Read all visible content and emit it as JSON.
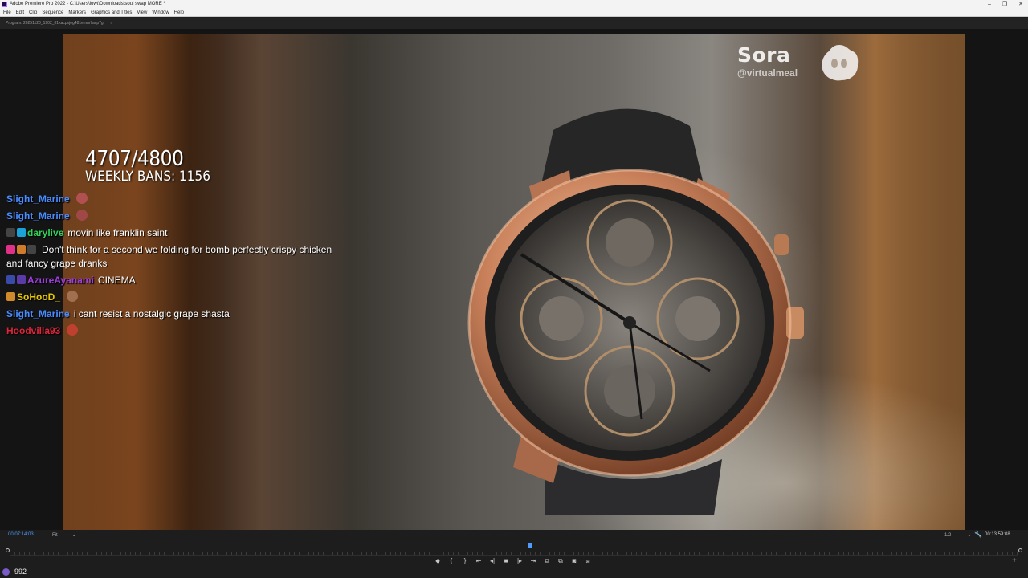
{
  "window": {
    "title": "Adobe Premiere Pro 2022 - C:\\Users\\lowt\\Downloads\\soul swap MORE *",
    "controls": [
      "–",
      "❐",
      "✕"
    ]
  },
  "menu": [
    "File",
    "Edit",
    "Clip",
    "Sequence",
    "Markers",
    "Graphics and Titles",
    "View",
    "Window",
    "Help"
  ],
  "program_tab": {
    "label": "Program: 20251120_1902_01kacpxjeg481emm7acp7gt",
    "menu_glyph": "≡"
  },
  "overlay": {
    "sora_name": "Sora",
    "sora_handle": "@virtualmeal",
    "count": "4707/4800",
    "weekly_bans": "WEEKLY BANS: 1156"
  },
  "chat": [
    {
      "user": "Slight_Marine",
      "color": "#4a8cff",
      "text": "",
      "badges": [],
      "emote": "#b05050"
    },
    {
      "user": "Slight_Marine",
      "color": "#4a8cff",
      "text": "",
      "badges": [],
      "emote": "#a04848"
    },
    {
      "user": "darylive",
      "color": "#2fd15a",
      "text": "movin like franklin saint",
      "badges": [
        "#444",
        "#1aa3d8"
      ],
      "emote": ""
    },
    {
      "user": "",
      "color": "#2233cc",
      "text": "Don't think for a second we folding for bomb perfectly crispy chicken and fancy grape dranks",
      "badges": [
        "#e0308a",
        "#d07b2a",
        "#444"
      ],
      "emote": ""
    },
    {
      "user": "AzureAyanami",
      "color": "#a13de0",
      "text": "CINEMA",
      "badges": [
        "#3a4aa8",
        "#5a3aa8"
      ],
      "emote": ""
    },
    {
      "user": "SoHooD_",
      "color": "#e8c800",
      "text": "",
      "badges": [
        "#d08a2a"
      ],
      "emote": "#a07050"
    },
    {
      "user": "Slight_Marine",
      "color": "#4a8cff",
      "text": "i cant resist a nostalgic grape shasta",
      "badges": [],
      "emote": ""
    },
    {
      "user": "Hoodvilla93",
      "color": "#e0243a",
      "text": "",
      "badges": [],
      "emote": "#c04030"
    }
  ],
  "player": {
    "current_time": "00:07:14:03",
    "fit": "Fit",
    "resolution": "1/2",
    "duration": "00:13:59:08",
    "playhead_fraction": 0.516
  },
  "transport": [
    "⬥",
    "{",
    "}",
    "⇤",
    "◂|",
    "■",
    "|▸",
    "⇥",
    "⧉",
    "⧉",
    "◙",
    "⧈"
  ],
  "add_button": "+",
  "taskbar": {
    "count": "992"
  },
  "icons": {
    "wrench": "wrench-icon",
    "app": "premiere-icon",
    "sora_logo": "sora-logo-icon"
  }
}
